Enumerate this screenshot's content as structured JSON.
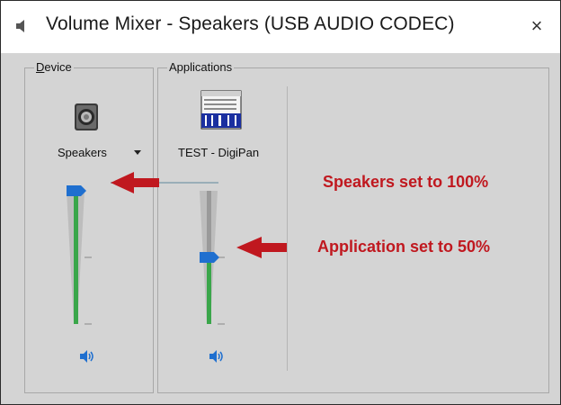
{
  "window": {
    "title": "Volume Mixer - Speakers (USB AUDIO  CODEC)",
    "close_label": "×",
    "title_icon": "speaker-icon"
  },
  "device_group": {
    "label_underlined": "D",
    "label_rest": "evice",
    "device_name": "Speakers",
    "device_icon": "speaker-device-icon",
    "volume_percent": 100,
    "mute_icon": "speaker-volume-icon"
  },
  "applications_group": {
    "label": "Applications",
    "apps": [
      {
        "name": "TEST - DigiPan",
        "icon": "digipan-app-icon",
        "volume_percent": 50,
        "mute_icon": "speaker-volume-icon"
      }
    ]
  },
  "annotations": {
    "speakers": "Speakers set to 100%",
    "application": "Application set to 50%",
    "arrow_color": "#c0181f"
  },
  "colors": {
    "thumb": "#1f6fcf",
    "level_green": "#3aa64a",
    "track": "#bfbfbf"
  }
}
